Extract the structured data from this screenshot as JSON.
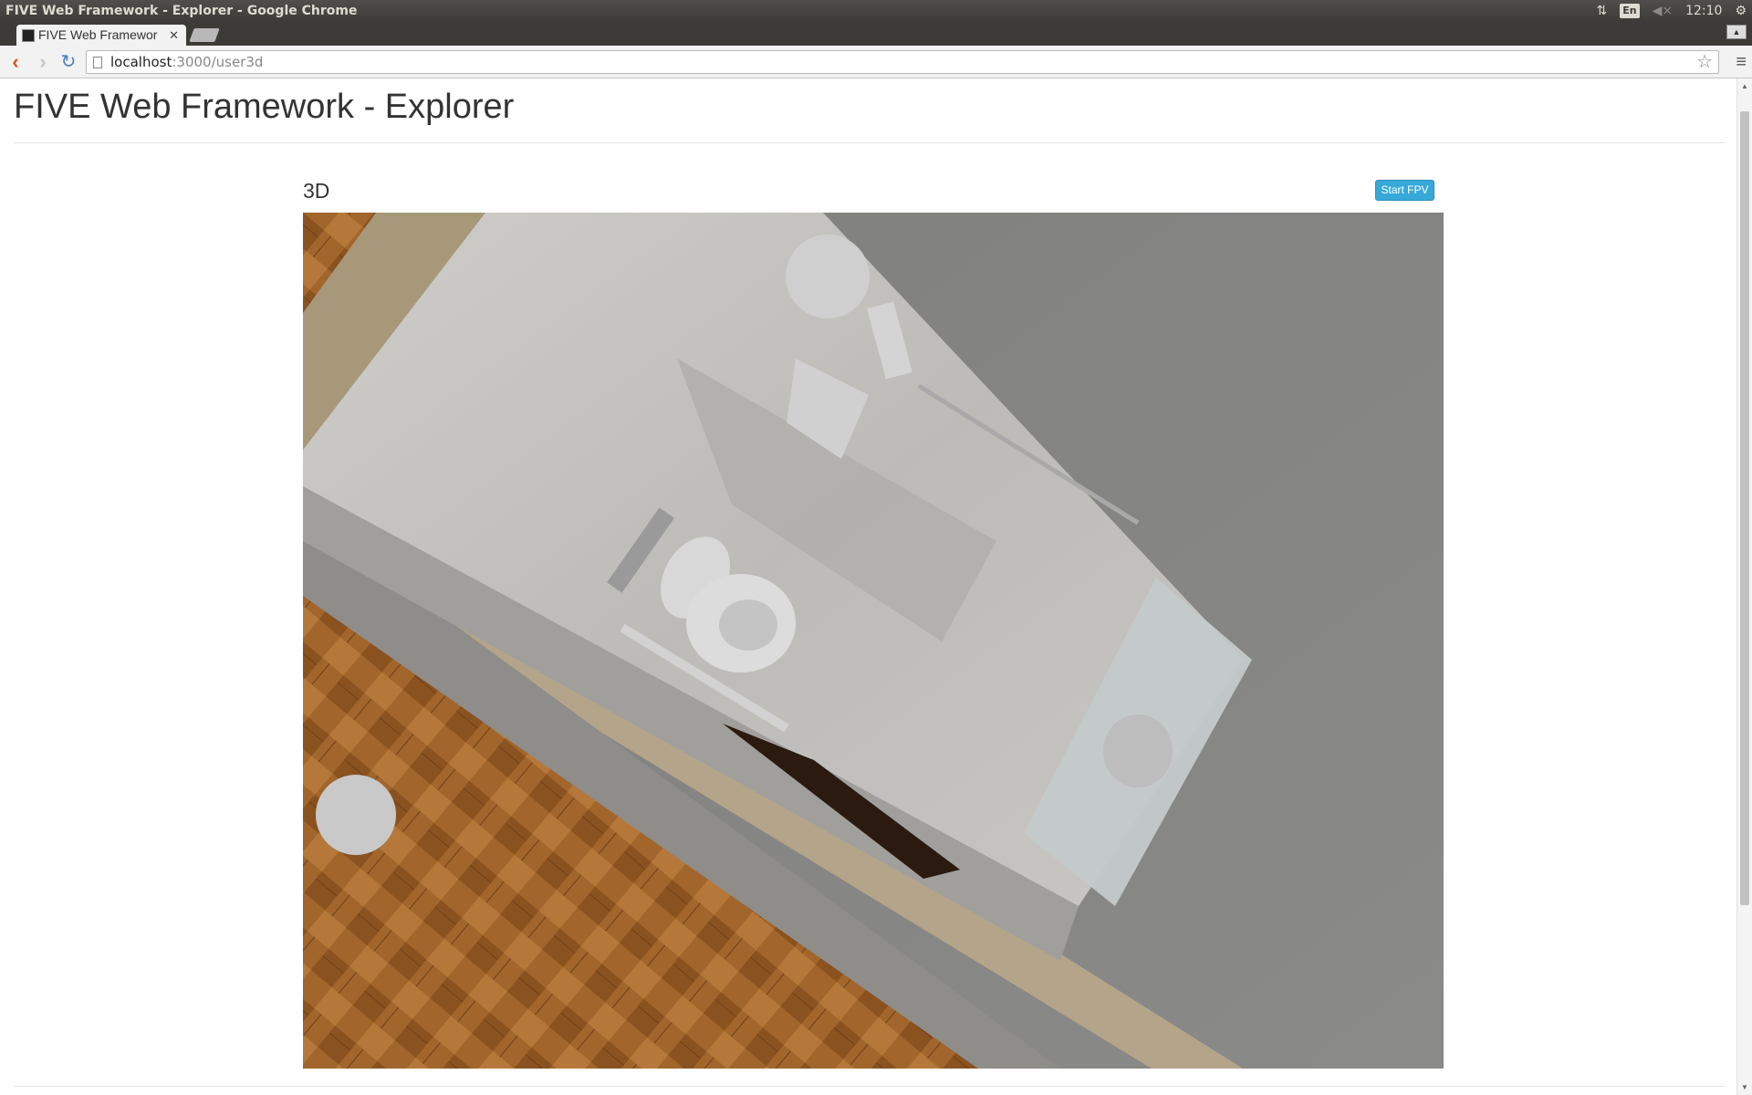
{
  "os": {
    "window_title": "FIVE Web Framework - Explorer - Google Chrome",
    "clock": "12:10",
    "keyboard": "En"
  },
  "browser": {
    "tab_title": "FIVE Web Framewor",
    "url_host": "localhost",
    "url_path": ":3000/user3d"
  },
  "page": {
    "title": "FIVE Web Framework - Explorer",
    "section_title": "3D",
    "fpv_button": "Start FPV"
  },
  "colors": {
    "fpv_button": "#37a9d8",
    "back_arrow": "#d9531e",
    "reload": "#4a7cc0"
  }
}
